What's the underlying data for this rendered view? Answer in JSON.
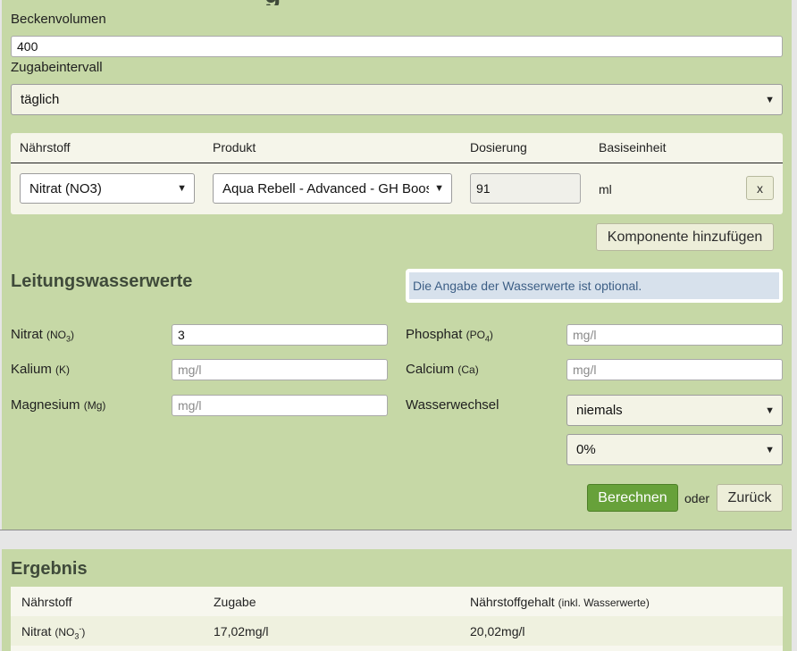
{
  "form": {
    "volume_label": "Beckenvolumen",
    "volume_value": "400",
    "interval_label": "Zugabeintervall",
    "interval_value": "täglich"
  },
  "components": {
    "headers": [
      "Nährstoff",
      "Produkt",
      "Dosierung",
      "Basiseinheit"
    ],
    "rows": [
      {
        "nutrient": "Nitrat (NO3)",
        "product": "Aqua Rebell - Advanced - GH Boos",
        "dose": "91",
        "unit": "ml",
        "remove": "x"
      }
    ],
    "add_button": "Komponente hinzufügen"
  },
  "tapwater": {
    "title": "Leitungswasserwerte",
    "info": "Die Angabe der Wasserwerte ist optional.",
    "nitrate": {
      "label": "Nitrat",
      "formula": "NO",
      "sub": "3",
      "value": "3",
      "placeholder": "mg/l"
    },
    "phosphate": {
      "label": "Phosphat",
      "formula": "PO",
      "sub": "4",
      "placeholder": "mg/l"
    },
    "potassium": {
      "label": "Kalium",
      "formula": "K",
      "placeholder": "mg/l"
    },
    "calcium": {
      "label": "Calcium",
      "formula": "Ca",
      "placeholder": "mg/l"
    },
    "magnesium": {
      "label": "Magnesium",
      "formula": "Mg",
      "placeholder": "mg/l"
    },
    "water_change": {
      "label": "Wasserwechsel",
      "frequency": "niemals",
      "percent": "0%"
    }
  },
  "actions": {
    "calculate": "Berechnen",
    "or": "oder",
    "back": "Zurück"
  },
  "result": {
    "title": "Ergebnis",
    "headers": {
      "nutrient": "Nährstoff",
      "addition": "Zugabe",
      "content": "Nährstoffgehalt",
      "content_note": "(inkl. Wasserwerte)"
    },
    "rows": [
      {
        "nutrient": "Nitrat",
        "formula": "NO",
        "sub": "3",
        "sup": "-",
        "addition": "17,02mg/l",
        "content": "20,02mg/l"
      }
    ]
  },
  "colors": {
    "panel": "#c6d8a6",
    "accent_button": "#67a13a",
    "info_bg": "#d7e1ec",
    "info_text": "#3d5f86"
  }
}
